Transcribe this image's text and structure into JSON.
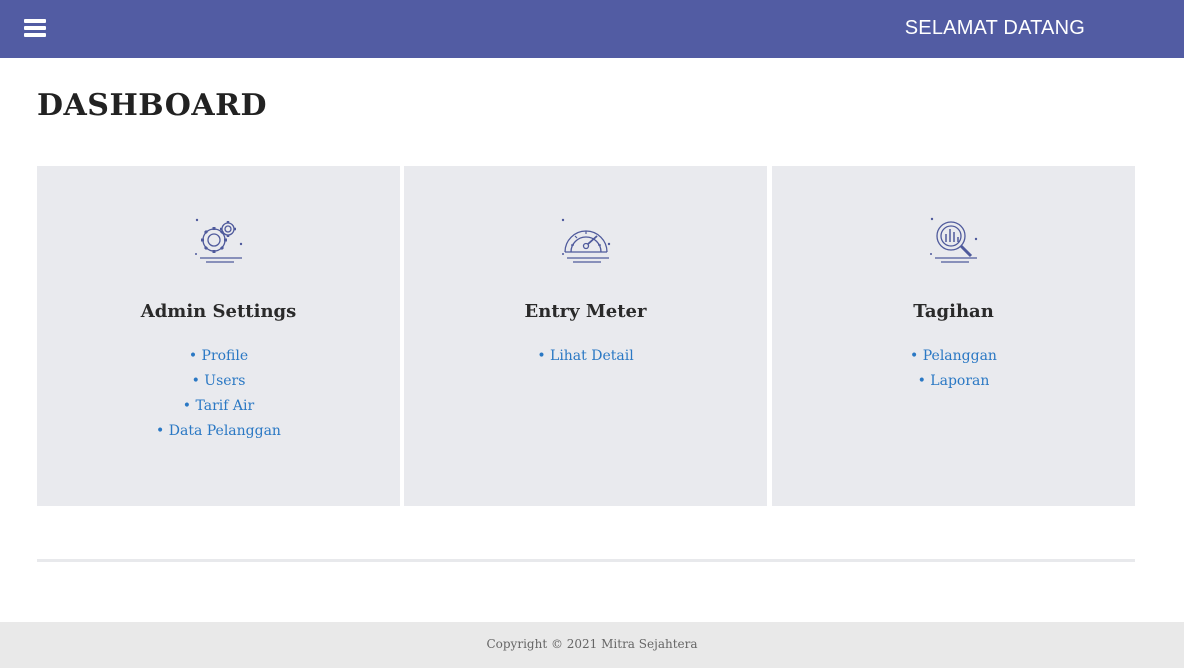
{
  "header": {
    "welcome_text": "SELAMAT DATANG",
    "background_color": "#525ca3",
    "menu_icon": "hamburger-menu-icon"
  },
  "main": {
    "title": "DASHBOARD",
    "cards": [
      {
        "icon": "gears-icon",
        "title": "Admin Settings",
        "links": [
          "• Profile",
          "• Users",
          "• Tarif Air",
          "• Data Pelanggan"
        ]
      },
      {
        "icon": "speedometer-icon",
        "title": "Entry Meter",
        "links": [
          "• Lihat Detail"
        ]
      },
      {
        "icon": "chart-magnifier-icon",
        "title": "Tagihan",
        "links": [
          "• Pelanggan",
          "• Laporan"
        ]
      }
    ],
    "card_background": "#e9eaee",
    "link_color": "#2a78c4"
  },
  "footer": {
    "copyright": "Copyright © 2021 Mitra Sejahtera"
  }
}
